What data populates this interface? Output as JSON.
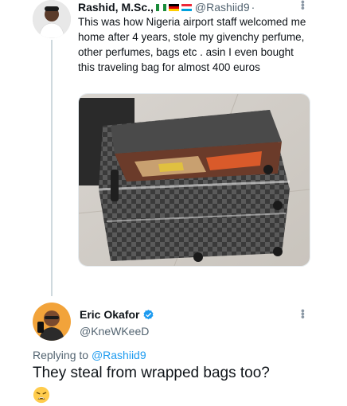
{
  "original_tweet": {
    "author_name": "Rashid, M.Sc.,",
    "handle": "@Rashiid9",
    "separator": "·",
    "flags": [
      "nigeria-flag",
      "germany-flag",
      "luxembourg-flag"
    ],
    "text": "This was how Nigeria airport staff welcomed me home after 4 years, stole my givenchy perfume, other perfumes, bags etc . asin I even bought this traveling bag for almost 400 euros",
    "media": "photo of wrapped suitcase ripped open"
  },
  "reply_tweet": {
    "author_name": "Eric Okafor",
    "handle": "@KneWKeeD",
    "replying_prefix": "Replying to",
    "replying_to": "@Rashiid9",
    "text": "They steal from wrapped bags too?",
    "emoji": "weary-face-emoji"
  },
  "colors": {
    "text": "#0f1419",
    "secondary": "#536471",
    "link": "#1d9bf0",
    "verified": "#1d9bf0",
    "thread_line": "#cfd9de"
  }
}
